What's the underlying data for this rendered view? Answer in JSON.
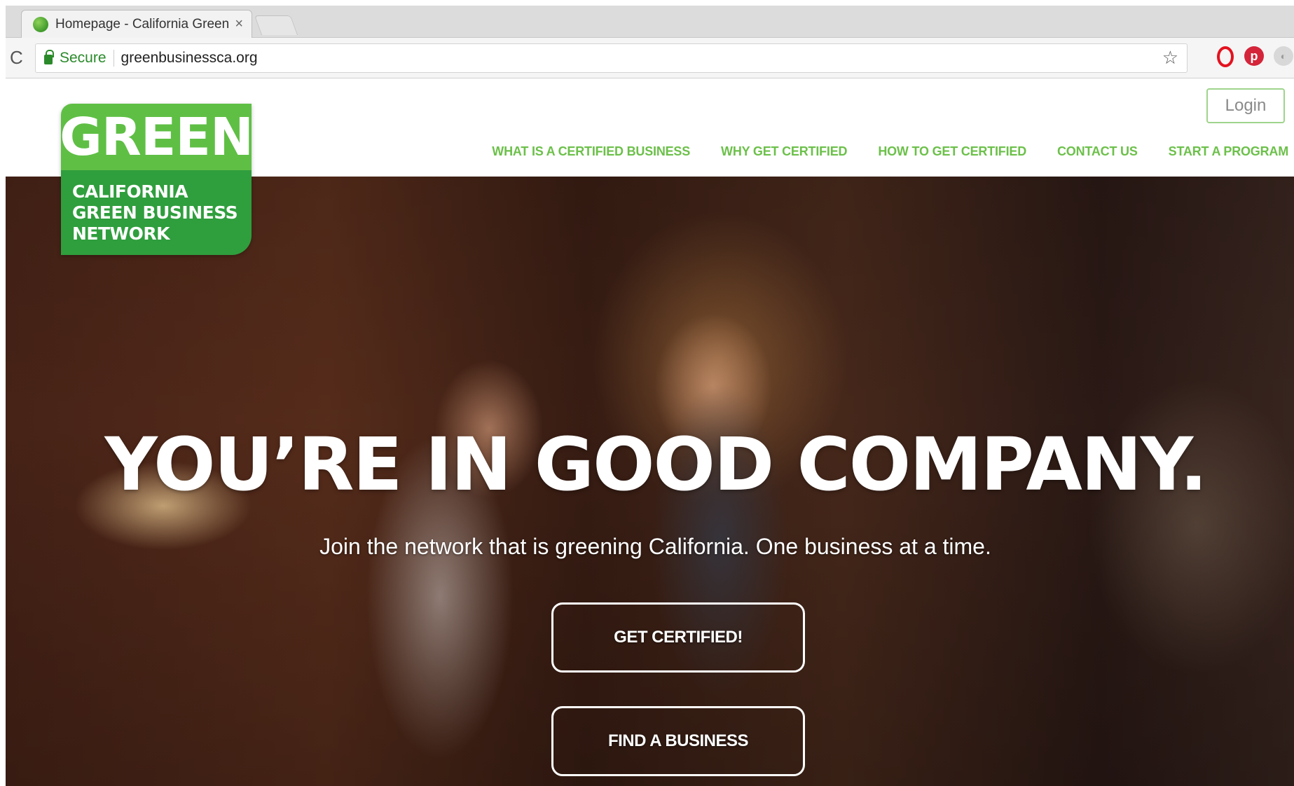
{
  "browser": {
    "tab_title": "Homepage - California Green",
    "tab_close": "×",
    "reload_glyph": "C",
    "secure_label": "Secure",
    "url": "greenbusinessca.org",
    "star_glyph": "☆",
    "extensions": [
      "opera-icon",
      "pinterest-icon",
      "extension-icon"
    ]
  },
  "site": {
    "login_label": "Login",
    "nav": [
      "WHAT IS A CERTIFIED BUSINESS",
      "WHY GET CERTIFIED",
      "HOW TO GET CERTIFIED",
      "CONTACT US",
      "START A PROGRAM"
    ],
    "logo": {
      "word": "GREEN",
      "lines": [
        "CALIFORNIA",
        "GREEN BUSINESS",
        "NETWORK"
      ]
    },
    "hero": {
      "headline": "YOU’RE IN GOOD COMPANY.",
      "subhead": "Join the network that is greening California. One business at a time.",
      "cta_primary": "GET CERTIFIED!",
      "cta_secondary": "FIND A BUSINESS"
    },
    "colors": {
      "nav_green": "#6cc04a",
      "logo_light_green": "#5fbf45",
      "logo_dark_green": "#2f9e3d",
      "secure_green": "#2a8a2a"
    }
  }
}
